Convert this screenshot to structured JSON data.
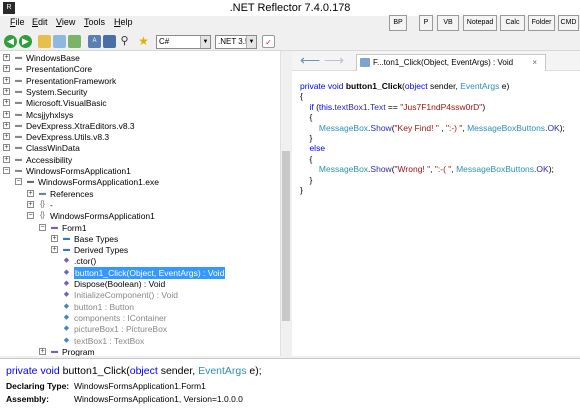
{
  "window": {
    "title": ".NET Reflector 7.4.0.178",
    "app_icon": "reflector-icon"
  },
  "menu": {
    "items": [
      {
        "label": "File",
        "underline": "F",
        "rest": "ile"
      },
      {
        "label": "Edit",
        "underline": "E",
        "rest": "dit"
      },
      {
        "label": "View",
        "underline": "V",
        "rest": "iew"
      },
      {
        "label": "Tools",
        "underline": "T",
        "rest": "ools"
      },
      {
        "label": "Help",
        "underline": "H",
        "rest": "elp"
      }
    ],
    "quick_buttons": [
      "BP",
      "P",
      "VB",
      "Notepad",
      "Calc",
      "Folder",
      "CMD"
    ]
  },
  "toolbar": {
    "language": "C#",
    "framework": ".NET 3.5"
  },
  "tree": {
    "items": [
      {
        "label": "WindowsBase",
        "toggle": "+",
        "icon": "assembly-icon"
      },
      {
        "label": "PresentationCore",
        "toggle": "+",
        "icon": "assembly-icon"
      },
      {
        "label": "PresentationFramework",
        "toggle": "+",
        "icon": "assembly-icon"
      },
      {
        "label": "System.Security",
        "toggle": "+",
        "icon": "assembly-icon"
      },
      {
        "label": "Microsoft.VisualBasic",
        "toggle": "+",
        "icon": "assembly-icon"
      },
      {
        "label": "Mcsjjyhxlsys",
        "toggle": "+",
        "icon": "assembly-icon"
      },
      {
        "label": "DevExpress.XtraEditors.v8.3",
        "toggle": "+",
        "icon": "assembly-icon"
      },
      {
        "label": "DevExpress.Utils.v8.3",
        "toggle": "+",
        "icon": "assembly-icon"
      },
      {
        "label": "ClassWinData",
        "toggle": "+",
        "icon": "assembly-icon"
      },
      {
        "label": "Accessibility",
        "toggle": "+",
        "icon": "assembly-icon"
      },
      {
        "label": "WindowsFormsApplication1",
        "toggle": "−",
        "icon": "assembly-icon"
      },
      {
        "label": "WindowsFormsApplication1.exe",
        "toggle": "−",
        "icon": "module-icon"
      },
      {
        "label": "References",
        "toggle": "+",
        "icon": "references-icon"
      },
      {
        "label": "-",
        "toggle": "+",
        "icon": "namespace-icon"
      },
      {
        "label": "WindowsFormsApplication1",
        "toggle": "−",
        "icon": "namespace-icon"
      },
      {
        "label": "Form1",
        "toggle": "−",
        "icon": "class-icon"
      },
      {
        "label": "Base Types",
        "toggle": "+",
        "icon": "base-types-icon"
      },
      {
        "label": "Derived Types",
        "toggle": "+",
        "icon": "derived-types-icon"
      },
      {
        "label": ".ctor()",
        "toggle": "",
        "icon": "method-icon"
      },
      {
        "label": "button1_Click(Object, EventArgs) : Void",
        "toggle": "",
        "icon": "method-icon",
        "selected": true
      },
      {
        "label": "Dispose(Boolean) : Void",
        "toggle": "",
        "icon": "method-icon"
      },
      {
        "label": "InitializeComponent() : Void",
        "toggle": "",
        "icon": "method-icon",
        "muted": true
      },
      {
        "label": "button1 : Button",
        "toggle": "",
        "icon": "field-icon",
        "muted": true
      },
      {
        "label": "components : IContainer",
        "toggle": "",
        "icon": "field-icon",
        "muted": true
      },
      {
        "label": "pictureBox1 : PictureBox",
        "toggle": "",
        "icon": "field-icon",
        "muted": true
      },
      {
        "label": "textBox1 : TextBox",
        "toggle": "",
        "icon": "field-icon",
        "muted": true
      },
      {
        "label": "Program",
        "toggle": "+",
        "icon": "class-icon"
      }
    ]
  },
  "code_panel": {
    "tab_title": "F...ton1_Click(Object, EventArgs) : Void",
    "lines": [
      [
        "kw:private ",
        "kw:void ",
        "fn:button1_Click",
        ":(",
        "kw:object",
        ": sender, ",
        "ty:EventArgs",
        ": e)"
      ],
      [
        ":{"
      ],
      [
        ":    ",
        "kw:if",
        ": (",
        "kw:this",
        ":.",
        "id:textBox1",
        ":.",
        "id:Text",
        ": == ",
        "str:\"Jus7F1ndP4ssw0rD\"",
        ":)"
      ],
      [
        ":    {"
      ],
      [
        ":        ",
        "ty:MessageBox",
        ":.",
        "id:Show",
        ":(",
        "str:\"Key Find! \"",
        ": , ",
        "str:\":-) \"",
        ":, ",
        "ty:MessageBoxButtons",
        ":.",
        "id:OK",
        ":);"
      ],
      [
        ":    }"
      ],
      [
        ":    ",
        "kw:else"
      ],
      [
        ":    {"
      ],
      [
        ":        ",
        "ty:MessageBox",
        ":.",
        "id:Show",
        ":(",
        "str:\"Wrong! \"",
        ":, ",
        "str:\":-( \"",
        ":, ",
        "ty:MessageBoxButtons",
        ":.",
        "id:OK",
        ":);"
      ],
      [
        ":    }"
      ],
      [
        ":}"
      ]
    ]
  },
  "description": {
    "sig_private": "private",
    "sig_void": "void",
    "sig_name": "button1_Click",
    "sig_open": "(",
    "sig_object": "object",
    "sig_sender": " sender, ",
    "sig_eventargs": "EventArgs",
    "sig_close": " e);",
    "declaring_label": "Declaring Type:",
    "declaring_value": "WindowsFormsApplication1.Form1",
    "assembly_label": "Assembly:",
    "assembly_value": "WindowsFormsApplication1, Version=1.0.0.0"
  }
}
